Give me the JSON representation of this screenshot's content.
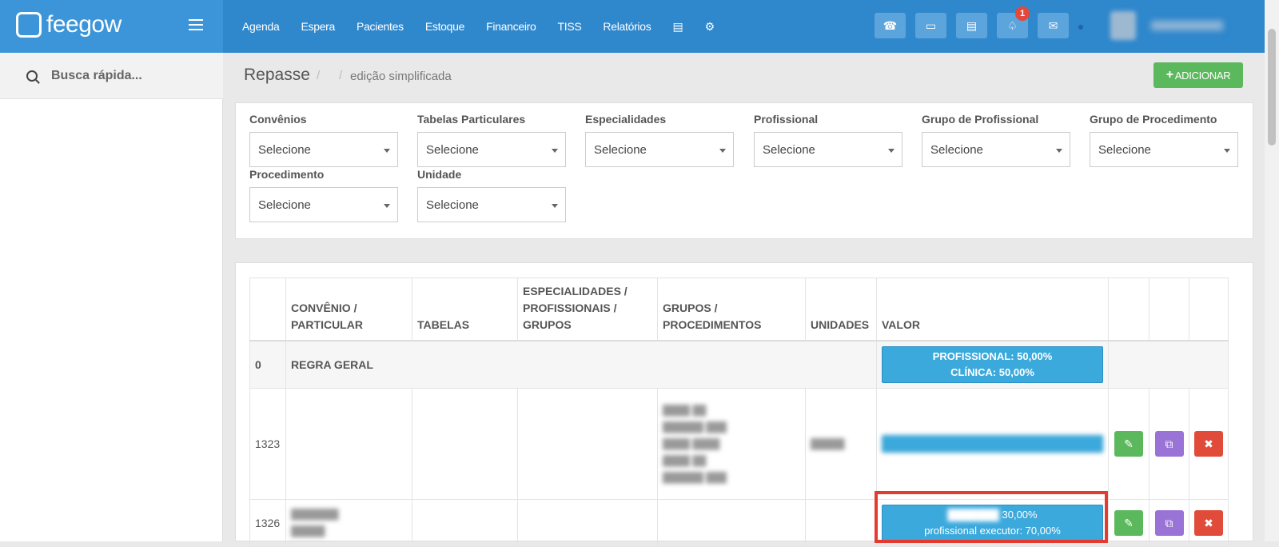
{
  "brand": {
    "name": "feegow"
  },
  "nav": {
    "items": [
      "Agenda",
      "Espera",
      "Pacientes",
      "Estoque",
      "Financeiro",
      "TISS",
      "Relatórios"
    ],
    "notification_count": "1"
  },
  "sidebar": {
    "search_placeholder": "Busca rápida..."
  },
  "header": {
    "title": "Repasse",
    "breadcrumb": "edição simplificada",
    "add_label": "ADICIONAR"
  },
  "filters": {
    "fields": [
      {
        "label": "Convênios",
        "value": "Selecione"
      },
      {
        "label": "Tabelas Particulares",
        "value": "Selecione"
      },
      {
        "label": "Especialidades",
        "value": "Selecione"
      },
      {
        "label": "Profissional",
        "value": "Selecione"
      },
      {
        "label": "Grupo de Profissional",
        "value": "Selecione"
      },
      {
        "label": "Grupo de Procedimento",
        "value": "Selecione"
      },
      {
        "label": "Procedimento",
        "value": "Selecione"
      },
      {
        "label": "Unidade",
        "value": "Selecione"
      }
    ]
  },
  "table": {
    "headers": [
      "",
      "CONVÊNIO / PARTICULAR",
      "TABELAS",
      "ESPECIALIDADES / PROFISSIONAIS / GRUPOS",
      "GRUPOS / PROCEDIMENTOS",
      "UNIDADES",
      "VALOR",
      "",
      "",
      ""
    ],
    "rows": [
      {
        "id": "0",
        "convenio": "REGRA GERAL",
        "valor_line1": "PROFISSIONAL: 50,00%",
        "valor_line2": "CLÍNICA: 50,00%"
      },
      {
        "id": "1323"
      },
      {
        "id": "1326",
        "valor_line1": "30,00%",
        "valor_line2": "profissional executor: 70,00%"
      }
    ]
  },
  "icons": {
    "phone": "phone-icon",
    "inbox": "inbox-icon",
    "card": "card-icon",
    "bell": "bell-icon",
    "chat": "chat-icon",
    "database": "database-icon",
    "gear": "gear-icon",
    "edit": "edit-icon",
    "copy": "copy-icon",
    "delete": "delete-icon"
  },
  "colors": {
    "topbar": "#2f87cc",
    "add_button": "#5cb85c",
    "value_box": "#3ba9dc",
    "edit": "#5cb85c",
    "copy": "#9a73d6",
    "delete": "#e04b3a",
    "highlight": "#e43a30"
  }
}
